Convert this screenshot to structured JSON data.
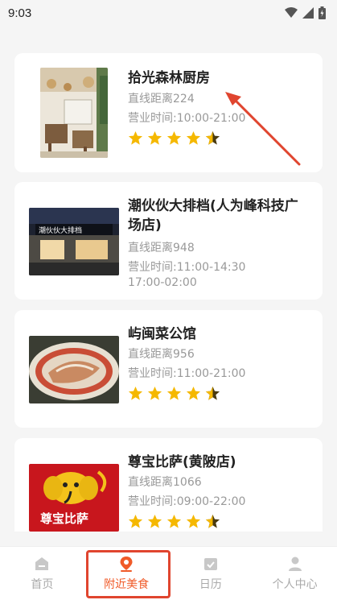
{
  "status": {
    "time": "9:03"
  },
  "restaurants": [
    {
      "name": "拾光森林厨房",
      "distance": "直线距离224",
      "hours": "营业时间:10:00-21:00",
      "rating": 4.5
    },
    {
      "name": "潮伙伙大排档(人为峰科技广场店)",
      "distance": "直线距离948",
      "hours": "营业时间:11:00-14:30",
      "hours2": "17:00-02:00",
      "sign_text": "潮伙伙大排档"
    },
    {
      "name": "屿闽菜公馆",
      "distance": "直线距离956",
      "hours": "营业时间:11:00-21:00",
      "rating": 4.5
    },
    {
      "name": "尊宝比萨(黄陂店)",
      "distance": "直线距离1066",
      "hours": "营业时间:09:00-22:00",
      "rating": 4.5,
      "logo_text": "尊宝比萨"
    }
  ],
  "tabs": [
    {
      "label": "首页",
      "icon": "home-icon",
      "active": false
    },
    {
      "label": "附近美食",
      "icon": "location-pin-icon",
      "active": true
    },
    {
      "label": "日历",
      "icon": "calendar-icon",
      "active": false
    },
    {
      "label": "个人中心",
      "icon": "person-icon",
      "active": false
    }
  ],
  "colors": {
    "accent": "#f05a28",
    "star": "#f5b800",
    "highlight": "#e0452f",
    "arrow": "#e0452f"
  }
}
